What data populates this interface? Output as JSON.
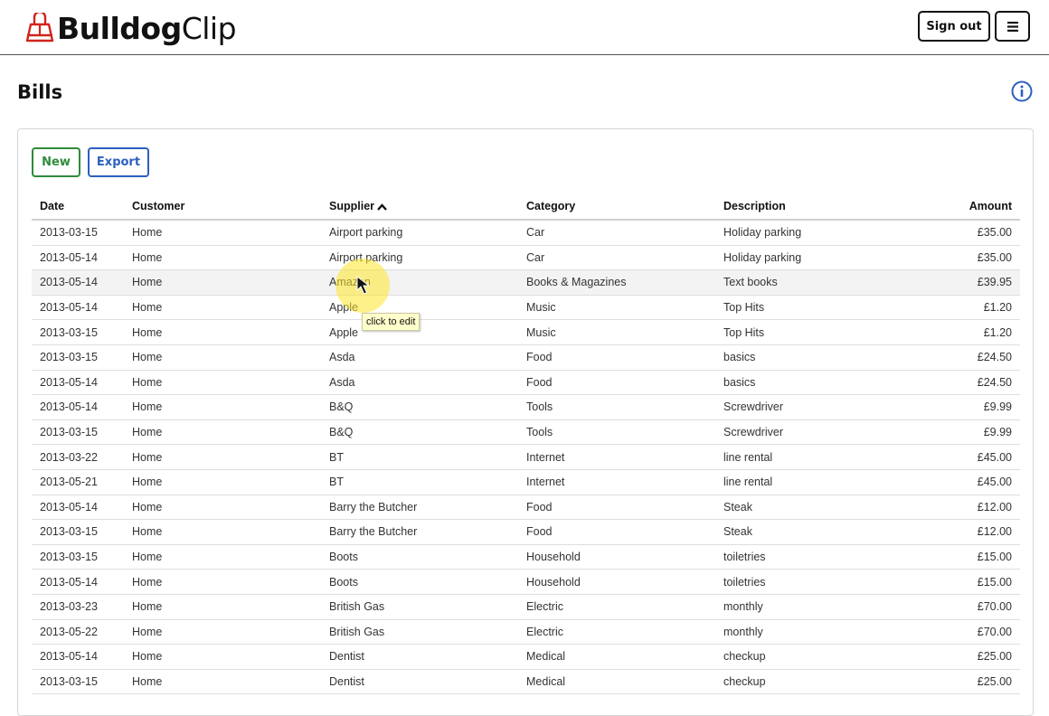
{
  "app": {
    "brand_strong": "Bulldog",
    "brand_light": "Clip",
    "logo_icon": "bulldog-clip-icon"
  },
  "header": {
    "signout_label": "Sign out",
    "menu_icon": "hamburger-menu-icon"
  },
  "page": {
    "title": "Bills",
    "info_icon": "info-icon"
  },
  "toolbar": {
    "new_label": "New",
    "export_label": "Export"
  },
  "table": {
    "columns": [
      "Date",
      "Customer",
      "Supplier",
      "Category",
      "Description",
      "Amount"
    ],
    "sorted_by": "Supplier",
    "rows": [
      [
        "2013-03-15",
        "Home",
        "Airport parking",
        "Car",
        "Holiday parking",
        "£35.00"
      ],
      [
        "2013-05-14",
        "Home",
        "Airport parking",
        "Car",
        "Holiday parking",
        "£35.00"
      ],
      [
        "2013-05-14",
        "Home",
        "Amazon",
        "Books & Magazines",
        "Text books",
        "£39.95"
      ],
      [
        "2013-05-14",
        "Home",
        "Apple",
        "Music",
        "Top Hits",
        "£1.20"
      ],
      [
        "2013-03-15",
        "Home",
        "Apple",
        "Music",
        "Top Hits",
        "£1.20"
      ],
      [
        "2013-03-15",
        "Home",
        "Asda",
        "Food",
        "basics",
        "£24.50"
      ],
      [
        "2013-05-14",
        "Home",
        "Asda",
        "Food",
        "basics",
        "£24.50"
      ],
      [
        "2013-05-14",
        "Home",
        "B&Q",
        "Tools",
        "Screwdriver",
        "£9.99"
      ],
      [
        "2013-03-15",
        "Home",
        "B&Q",
        "Tools",
        "Screwdriver",
        "£9.99"
      ],
      [
        "2013-03-22",
        "Home",
        "BT",
        "Internet",
        "line rental",
        "£45.00"
      ],
      [
        "2013-05-21",
        "Home",
        "BT",
        "Internet",
        "line rental",
        "£45.00"
      ],
      [
        "2013-05-14",
        "Home",
        "Barry the Butcher",
        "Food",
        "Steak",
        "£12.00"
      ],
      [
        "2013-03-15",
        "Home",
        "Barry the Butcher",
        "Food",
        "Steak",
        "£12.00"
      ],
      [
        "2013-03-15",
        "Home",
        "Boots",
        "Household",
        "toiletries",
        "£15.00"
      ],
      [
        "2013-05-14",
        "Home",
        "Boots",
        "Household",
        "toiletries",
        "£15.00"
      ],
      [
        "2013-03-23",
        "Home",
        "British Gas",
        "Electric",
        "monthly",
        "£70.00"
      ],
      [
        "2013-05-22",
        "Home",
        "British Gas",
        "Electric",
        "monthly",
        "£70.00"
      ],
      [
        "2013-05-14",
        "Home",
        "Dentist",
        "Medical",
        "checkup",
        "£25.00"
      ],
      [
        "2013-03-15",
        "Home",
        "Dentist",
        "Medical",
        "checkup",
        "£25.00"
      ]
    ]
  },
  "tooltip": {
    "text": "click to edit"
  },
  "colors": {
    "new_green": "#2e8b3a",
    "export_blue": "#2d5fbf",
    "brand_red": "#d0241c",
    "info_blue": "#2d5fbf"
  }
}
